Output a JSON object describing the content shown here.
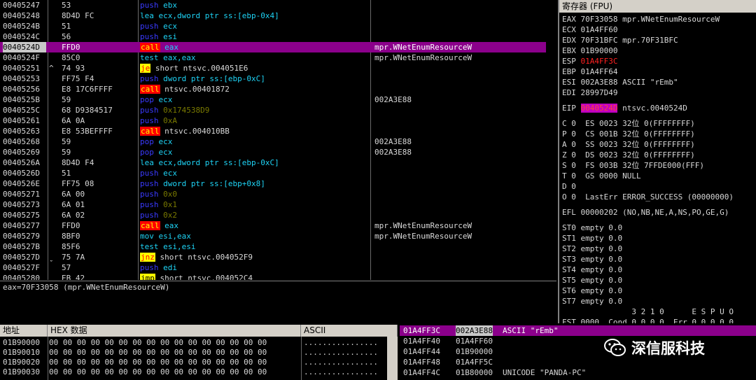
{
  "cpu": {
    "rows": [
      {
        "addr": "00405247",
        "mark": "",
        "hex": "53",
        "mn": "push",
        "mk": "push",
        "ops": [
          [
            "reg",
            "ebx"
          ]
        ],
        "cmt": ""
      },
      {
        "addr": "00405248",
        "mark": "",
        "hex": "8D4D FC",
        "mn": "lea",
        "mk": "lea",
        "ops": [
          [
            "reg",
            "ecx,dword ptr ss:[ebp-0x4]"
          ]
        ],
        "cmt": ""
      },
      {
        "addr": "0040524B",
        "mark": "",
        "hex": "51",
        "mn": "push",
        "mk": "push",
        "ops": [
          [
            "reg",
            "ecx"
          ]
        ],
        "cmt": ""
      },
      {
        "addr": "0040524C",
        "mark": "",
        "hex": "56",
        "mn": "push",
        "mk": "push",
        "ops": [
          [
            "reg",
            "esi"
          ]
        ],
        "cmt": ""
      },
      {
        "addr": "0040524D",
        "mark": "",
        "hex": "FFD0",
        "mn": "call",
        "mk": "call",
        "ops": [
          [
            "reg",
            "eax"
          ]
        ],
        "cmt": "mpr.WNetEnumResourceW",
        "sel": true
      },
      {
        "addr": "0040524F",
        "mark": "",
        "hex": "85C0",
        "mn": "test",
        "mk": "test",
        "ops": [
          [
            "reg",
            "eax,eax"
          ]
        ],
        "cmt": "mpr.WNetEnumResourceW"
      },
      {
        "addr": "00405251",
        "mark": "^",
        "hex": "74 93",
        "mn": "je",
        "mk": "jcc",
        "ops": [
          [
            "lbl",
            "short ntsvc.004051E6"
          ]
        ],
        "cmt": ""
      },
      {
        "addr": "00405253",
        "mark": "",
        "hex": "FF75 F4",
        "mn": "push",
        "mk": "push",
        "ops": [
          [
            "reg",
            "dword ptr ss:[ebp-0xC]"
          ]
        ],
        "cmt": ""
      },
      {
        "addr": "00405256",
        "mark": "",
        "hex": "E8 17C6FFFF",
        "mn": "call",
        "mk": "call",
        "ops": [
          [
            "lbl",
            "ntsvc.00401872"
          ]
        ],
        "cmt": ""
      },
      {
        "addr": "0040525B",
        "mark": "",
        "hex": "59",
        "mn": "pop",
        "mk": "pop",
        "ops": [
          [
            "reg",
            "ecx"
          ]
        ],
        "cmt": "002A3E88"
      },
      {
        "addr": "0040525C",
        "mark": "",
        "hex": "68 D9384517",
        "mn": "push",
        "mk": "push",
        "ops": [
          [
            "imm",
            "0x174538D9"
          ]
        ],
        "cmt": ""
      },
      {
        "addr": "00405261",
        "mark": "",
        "hex": "6A 0A",
        "mn": "push",
        "mk": "push",
        "ops": [
          [
            "imm",
            "0xA"
          ]
        ],
        "cmt": ""
      },
      {
        "addr": "00405263",
        "mark": "",
        "hex": "E8 53BEFFFF",
        "mn": "call",
        "mk": "call",
        "ops": [
          [
            "lbl",
            "ntsvc.004010BB"
          ]
        ],
        "cmt": ""
      },
      {
        "addr": "00405268",
        "mark": "",
        "hex": "59",
        "mn": "pop",
        "mk": "pop",
        "ops": [
          [
            "reg",
            "ecx"
          ]
        ],
        "cmt": "002A3E88"
      },
      {
        "addr": "00405269",
        "mark": "",
        "hex": "59",
        "mn": "pop",
        "mk": "pop",
        "ops": [
          [
            "reg",
            "ecx"
          ]
        ],
        "cmt": "002A3E88"
      },
      {
        "addr": "0040526A",
        "mark": "",
        "hex": "8D4D F4",
        "mn": "lea",
        "mk": "lea",
        "ops": [
          [
            "reg",
            "ecx,dword ptr ss:[ebp-0xC]"
          ]
        ],
        "cmt": ""
      },
      {
        "addr": "0040526D",
        "mark": "",
        "hex": "51",
        "mn": "push",
        "mk": "push",
        "ops": [
          [
            "reg",
            "ecx"
          ]
        ],
        "cmt": ""
      },
      {
        "addr": "0040526E",
        "mark": "",
        "hex": "FF75 08",
        "mn": "push",
        "mk": "push",
        "ops": [
          [
            "reg",
            "dword ptr ss:[ebp+0x8]"
          ]
        ],
        "cmt": ""
      },
      {
        "addr": "00405271",
        "mark": "",
        "hex": "6A 00",
        "mn": "push",
        "mk": "push",
        "ops": [
          [
            "imm",
            "0x0"
          ]
        ],
        "cmt": ""
      },
      {
        "addr": "00405273",
        "mark": "",
        "hex": "6A 01",
        "mn": "push",
        "mk": "push",
        "ops": [
          [
            "imm",
            "0x1"
          ]
        ],
        "cmt": ""
      },
      {
        "addr": "00405275",
        "mark": "",
        "hex": "6A 02",
        "mn": "push",
        "mk": "push",
        "ops": [
          [
            "imm",
            "0x2"
          ]
        ],
        "cmt": ""
      },
      {
        "addr": "00405277",
        "mark": "",
        "hex": "FFD0",
        "mn": "call",
        "mk": "call",
        "ops": [
          [
            "reg",
            "eax"
          ]
        ],
        "cmt": "mpr.WNetEnumResourceW"
      },
      {
        "addr": "00405279",
        "mark": "",
        "hex": "8BF0",
        "mn": "mov",
        "mk": "mov",
        "ops": [
          [
            "reg",
            "esi,eax"
          ]
        ],
        "cmt": "mpr.WNetEnumResourceW"
      },
      {
        "addr": "0040527B",
        "mark": "",
        "hex": "85F6",
        "mn": "test",
        "mk": "test",
        "ops": [
          [
            "reg",
            "esi,esi"
          ]
        ],
        "cmt": ""
      },
      {
        "addr": "0040527D",
        "mark": "ˬ",
        "hex": "75 7A",
        "mn": "jnz",
        "mk": "jcc",
        "ops": [
          [
            "lbl",
            "short ntsvc.004052F9"
          ]
        ],
        "cmt": ""
      },
      {
        "addr": "0040527F",
        "mark": "",
        "hex": "57",
        "mn": "push",
        "mk": "push",
        "ops": [
          [
            "reg",
            "edi"
          ]
        ],
        "cmt": ""
      },
      {
        "addr": "00405280",
        "mark": "",
        "hex": "EB 42",
        "mn": "jmp",
        "mk": "jmp",
        "ops": [
          [
            "lbl",
            "short ntsvc.004052C4"
          ]
        ],
        "cmt": ""
      }
    ]
  },
  "info": {
    "text": "eax=70F33058 (mpr.WNetEnumResourceW)"
  },
  "registers": {
    "title": "寄存器 (FPU)",
    "lines": [
      [
        "EAX 70F33058 mpr.WNetEnumResourceW"
      ],
      [
        "ECX 01A4FF60"
      ],
      [
        "EDX 70F31BFC mpr.70F31BFC"
      ],
      [
        "EBX 01B90000"
      ],
      [
        "ESP ",
        "01A4FF3C"
      ],
      [
        "EBP 01A4FF64"
      ],
      [
        "ESI 002A3E88 ASCII \"rEmb\""
      ],
      [
        "EDI 28997D49"
      ],
      [
        ""
      ],
      [
        "EIP ",
        "0040524D",
        " ntsvc.0040524D"
      ],
      [
        ""
      ],
      [
        "C 0  ES 0023 32位 0(FFFFFFFF)"
      ],
      [
        "P 0  CS 001B 32位 0(FFFFFFFF)"
      ],
      [
        "A 0  SS 0023 32位 0(FFFFFFFF)"
      ],
      [
        "Z 0  DS 0023 32位 0(FFFFFFFF)"
      ],
      [
        "S 0  FS 003B 32位 7FFDE000(FFF)"
      ],
      [
        "T 0  GS 0000 NULL"
      ],
      [
        "D 0"
      ],
      [
        "O 0  LastErr ERROR_SUCCESS (00000000)"
      ],
      [
        ""
      ],
      [
        "EFL 00000202 (NO,NB,NE,A,NS,PO,GE,G)"
      ],
      [
        ""
      ],
      [
        "ST0 empty 0.0"
      ],
      [
        "ST1 empty 0.0"
      ],
      [
        "ST2 empty 0.0"
      ],
      [
        "ST3 empty 0.0"
      ],
      [
        "ST4 empty 0.0"
      ],
      [
        "ST5 empty 0.0"
      ],
      [
        "ST6 empty 0.0"
      ],
      [
        "ST7 empty 0.0"
      ],
      [
        "               3 2 1 0      E S P U O"
      ],
      [
        "FST 0000  Cond 0 0 0 0  Err 0 0 0 0 0"
      ]
    ]
  },
  "dump": {
    "header_addr": "地址",
    "header_hex": "HEX 数据",
    "header_ascii": "ASCII",
    "rows": [
      {
        "addr": "01B90000",
        "hex": "00 00 00 00 00 00 00 00 00 00 00 00 00 00 00 00",
        "ascii": "................"
      },
      {
        "addr": "01B90010",
        "hex": "00 00 00 00 00 00 00 00 00 00 00 00 00 00 00 00",
        "ascii": "................"
      },
      {
        "addr": "01B90020",
        "hex": "00 00 00 00 00 00 00 00 00 00 00 00 00 00 00 00",
        "ascii": "................"
      },
      {
        "addr": "01B90030",
        "hex": "00 00 00 00 00 00 00 00 00 00 00 00 00 00 00 00",
        "ascii": "................"
      }
    ]
  },
  "stack": {
    "rows": [
      {
        "addr": "01A4FF3C",
        "val": "002A3E88",
        "cmt": "ASCII \"rEmb\"",
        "sel": true
      },
      {
        "addr": "01A4FF40",
        "val": "01A4FF60",
        "cmt": ""
      },
      {
        "addr": "01A4FF44",
        "val": "01B90000",
        "cmt": ""
      },
      {
        "addr": "01A4FF48",
        "val": "01A4FF5C",
        "cmt": ""
      },
      {
        "addr": "01A4FF4C",
        "val": "01B80000",
        "cmt": "UNICODE \"PANDA-PC\""
      }
    ]
  },
  "watermark": {
    "text": "深信服科技",
    "icon": "wechat-icon"
  },
  "colors": {
    "selection": "#8b008b",
    "call_bg": "#ff0000",
    "jump_bg": "#ffff00",
    "push_pop": "#3a3aff",
    "operand": "#1ed3f5"
  }
}
